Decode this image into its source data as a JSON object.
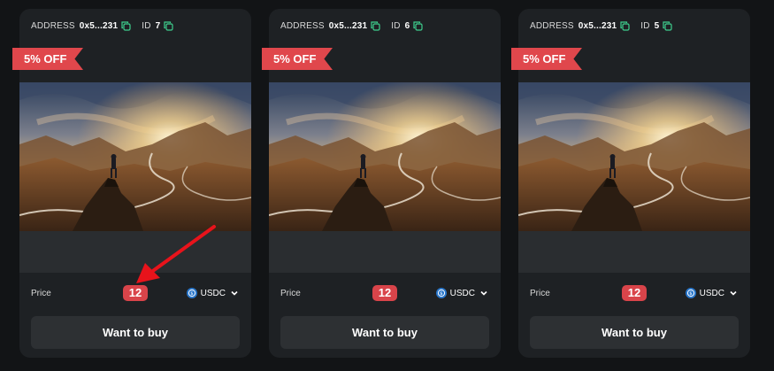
{
  "labels": {
    "address": "ADDRESS",
    "id": "ID",
    "price": "Price",
    "buy": "Want to buy"
  },
  "cards": [
    {
      "address": "0x5...231",
      "id": "7",
      "discount": "5% OFF",
      "price": "12",
      "currency": "USDC"
    },
    {
      "address": "0x5...231",
      "id": "6",
      "discount": "5% OFF",
      "price": "12",
      "currency": "USDC"
    },
    {
      "address": "0x5...231",
      "id": "5",
      "discount": "5% OFF",
      "price": "12",
      "currency": "USDC"
    }
  ],
  "icons": {
    "copy": "copy-icon",
    "currency": "usdc-icon",
    "dropdown": "chevron-down-icon"
  },
  "colors": {
    "accent_green": "#3ecf8e",
    "discount_red": "#e0474c",
    "price_red": "#d9444a",
    "usdc_blue": "#2775ca",
    "annotation_arrow": "#e8131b"
  }
}
